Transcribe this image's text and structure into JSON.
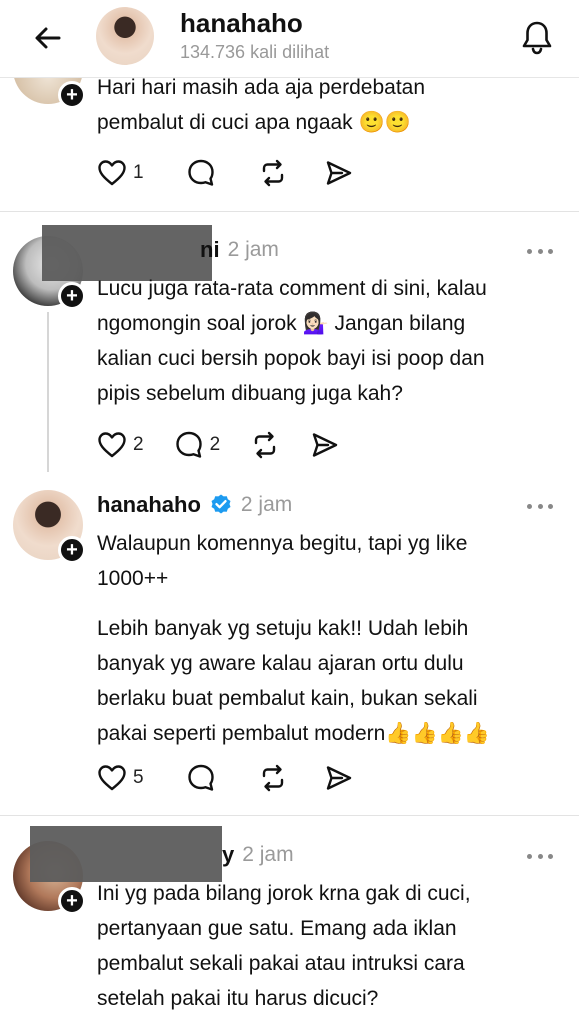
{
  "header": {
    "username": "hanahaho",
    "views": "134.736 kali dilihat"
  },
  "posts": [
    {
      "text_lines": [
        "Hari hari masih ada aja perdebatan",
        "pembalut di cuci apa ngaak 🙂🙂"
      ],
      "actions": {
        "like": "1",
        "comment": "",
        "repost": "",
        "share": ""
      }
    },
    {
      "name": "ni",
      "time": "2 jam",
      "text_lines": [
        "Lucu juga rata-rata comment di sini, kalau",
        "ngomongin soal jorok 💁🏻‍♀️  Jangan bilang",
        "kalian cuci bersih popok bayi isi poop dan",
        "pipis sebelum dibuang juga kah?"
      ],
      "actions": {
        "like": "2",
        "comment": "2",
        "repost": "",
        "share": ""
      }
    },
    {
      "name": "hanahaho",
      "time": "2 jam",
      "verified": true,
      "paragraph1": [
        "Walaupun komennya begitu, tapi yg like",
        "1000++"
      ],
      "paragraph2": [
        "Lebih banyak yg setuju kak!! Udah lebih",
        "banyak yg aware kalau ajaran ortu dulu",
        "berlaku buat pembalut kain, bukan sekali",
        "pakai seperti pembalut modern👍👍👍👍"
      ],
      "actions": {
        "like": "5",
        "comment": "",
        "repost": "",
        "share": ""
      }
    },
    {
      "name": "y",
      "time": "2 jam",
      "text_lines": [
        "Ini yg pada bilang jorok krna gak di cuci,",
        "pertanyaan gue satu. Emang ada iklan",
        "pembalut sekali pakai atau intruksi cara",
        "setelah pakai itu harus dicuci?"
      ]
    }
  ],
  "icons": {
    "back": "arrow-left-icon",
    "bell": "bell-icon",
    "like": "heart-icon",
    "comment": "speech-bubble-icon",
    "repost": "repost-icon",
    "share": "send-icon",
    "more": "more-dots-icon",
    "verified": "verified-badge-icon",
    "follow": "plus-icon"
  },
  "colors": {
    "verified": "#1d9bf0",
    "muted": "#9a9a9a"
  }
}
